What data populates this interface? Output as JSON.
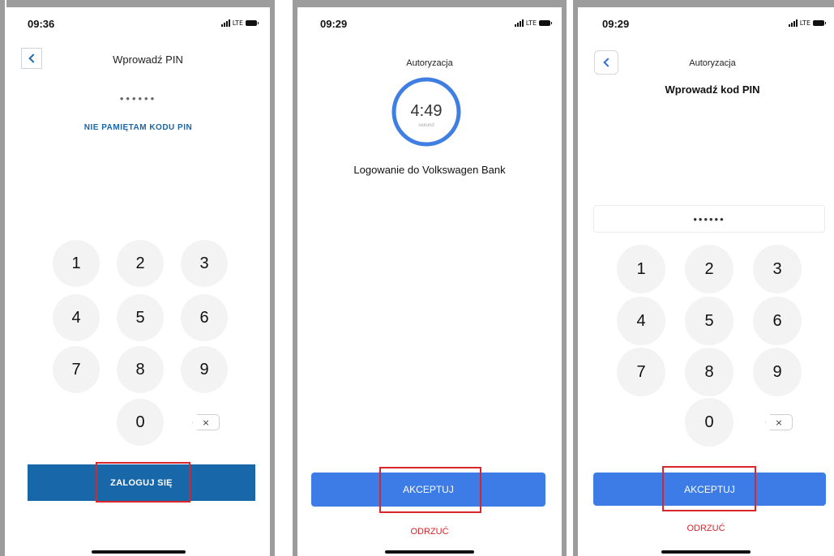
{
  "screens": [
    {
      "status_time": "09:36",
      "network": "LTE",
      "title": "Wprowadź PIN",
      "pin_mask": "••••••",
      "forgot_link": "NIE PAMIĘTAM KODU PIN",
      "keys": [
        "1",
        "2",
        "3",
        "4",
        "5",
        "6",
        "7",
        "8",
        "9",
        "0"
      ],
      "delete_glyph": "×",
      "cta_label": "ZALOGUJ SIĘ",
      "cta_color": "#1867a8"
    },
    {
      "status_time": "09:29",
      "network": "LTE",
      "header": "Autoryzacja",
      "timer_value": "4:49",
      "timer_unit": "sekund",
      "message": "Logowanie do Volkswagen Bank",
      "accept_label": "AKCEPTUJ",
      "reject_label": "ODRZUĆ",
      "accept_color": "#3d7ce6",
      "reject_color": "#d8222a"
    },
    {
      "status_time": "09:29",
      "network": "LTE",
      "header": "Autoryzacja",
      "title": "Wprowadź kod PIN",
      "pin_mask": "••••••",
      "keys": [
        "1",
        "2",
        "3",
        "4",
        "5",
        "6",
        "7",
        "8",
        "9",
        "0"
      ],
      "delete_glyph": "×",
      "accept_label": "AKCEPTUJ",
      "reject_label": "ODRZUĆ",
      "accept_color": "#3d7ce6",
      "reject_color": "#d8222a"
    }
  ],
  "highlight_color": "#d9262b"
}
